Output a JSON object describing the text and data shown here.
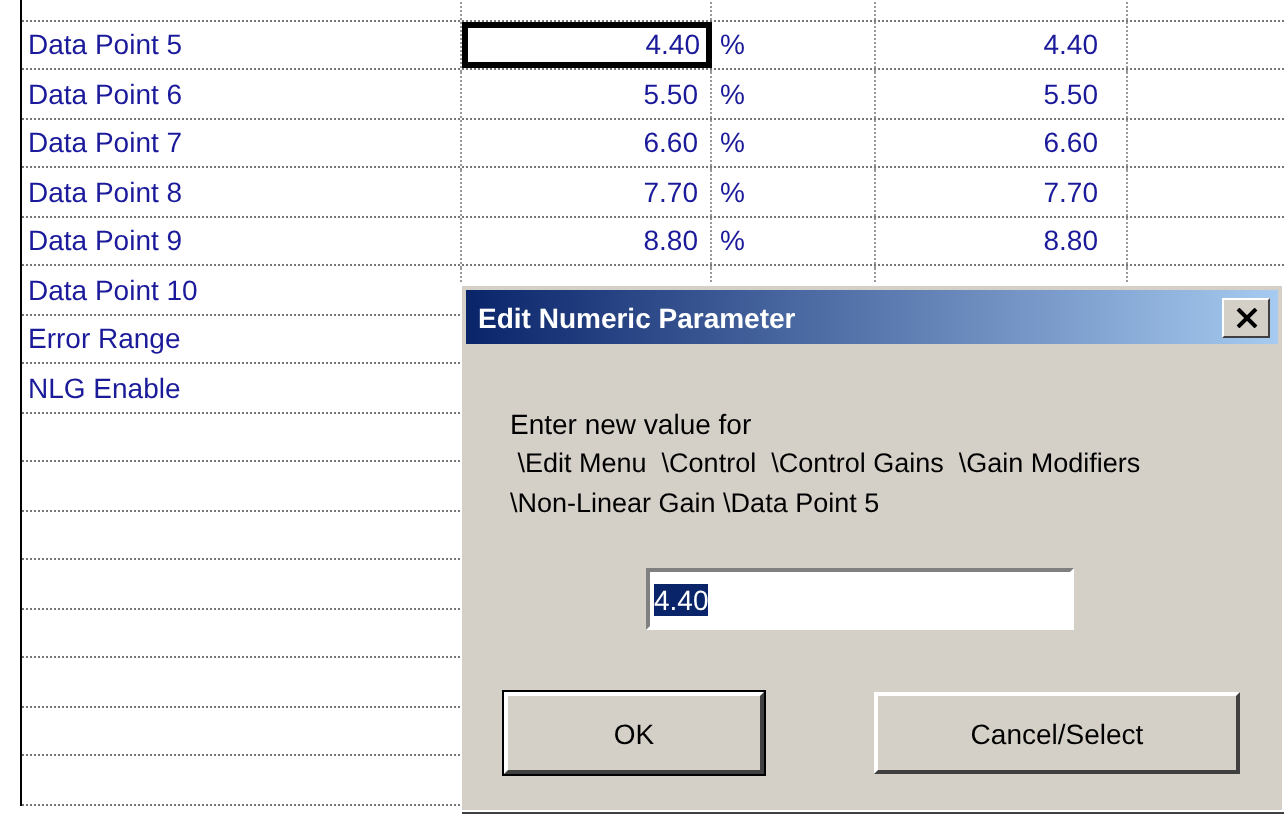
{
  "table": {
    "rows": [
      {
        "label": "Data Point 5",
        "value": {
          "text": "4.40",
          "selected": true
        },
        "unit": "%",
        "value_2": "4.40"
      },
      {
        "label": "Data Point 6",
        "value": {
          "text": "5.50",
          "selected": false
        },
        "unit": "%",
        "value_2": "5.50"
      },
      {
        "label": "Data Point 7",
        "value": {
          "text": "6.60",
          "selected": false
        },
        "unit": "%",
        "value_2": "6.60"
      },
      {
        "label": "Data Point 8",
        "value": {
          "text": "7.70",
          "selected": false
        },
        "unit": "%",
        "value_2": "7.70"
      },
      {
        "label": "Data Point 9",
        "value": {
          "text": "8.80",
          "selected": false
        },
        "unit": "%",
        "value_2": "8.80"
      },
      {
        "label": "Data Point 10"
      },
      {
        "label": "Error Range"
      },
      {
        "label": "NLG Enable"
      }
    ]
  },
  "dialog": {
    "title": "Edit Numeric Parameter",
    "prompt": "Enter new value for",
    "path": " \\Edit Menu  \\Control  \\Control Gains  \\Gain Modifiers  \\Non-Linear Gain \\Data Point 5",
    "value": "4.40",
    "buttons": [
      "OK",
      "Cancel/Select"
    ]
  }
}
